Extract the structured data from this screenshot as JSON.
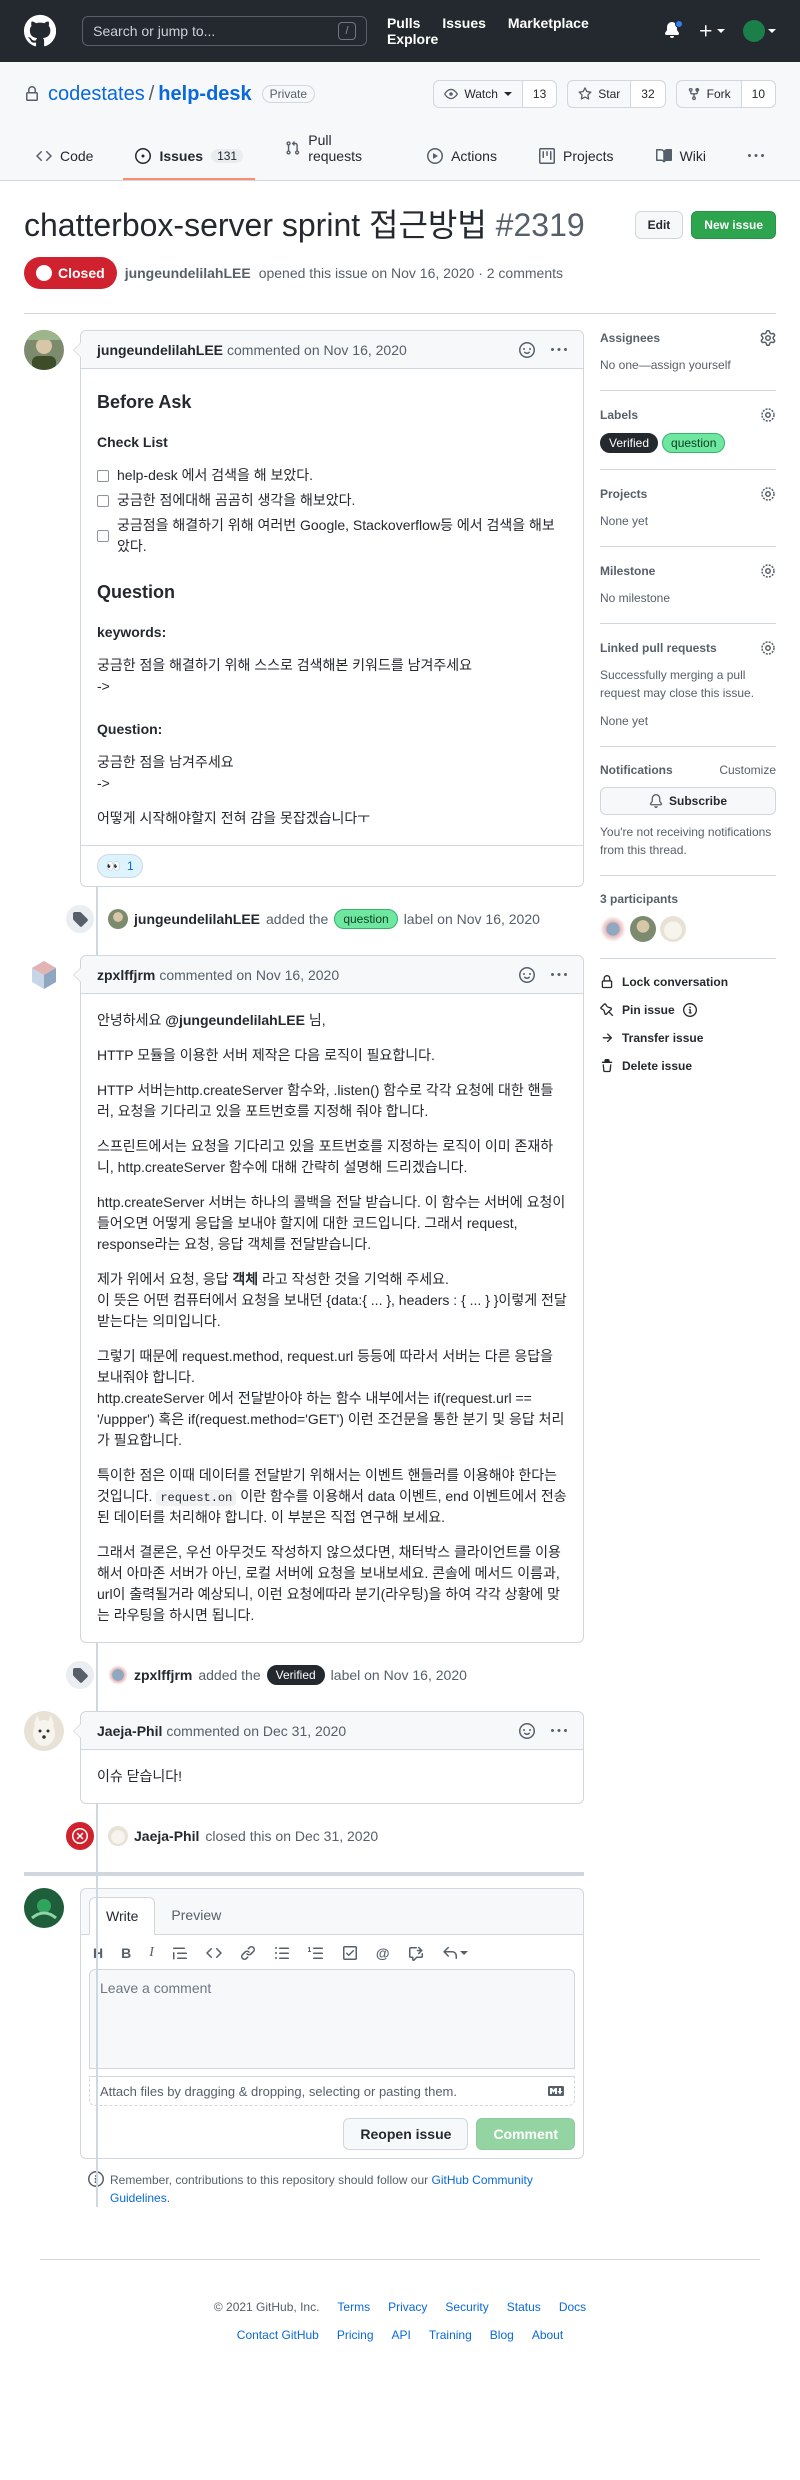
{
  "header": {
    "search_placeholder": "Search or jump to...",
    "search_key": "/",
    "nav": [
      "Pulls",
      "Issues",
      "Marketplace",
      "Explore"
    ]
  },
  "repo": {
    "owner": "codestates",
    "name": "help-desk",
    "visibility": "Private",
    "watch_label": "Watch",
    "watch_count": "13",
    "star_label": "Star",
    "star_count": "32",
    "fork_label": "Fork",
    "fork_count": "10",
    "tabs": [
      {
        "label": "Code"
      },
      {
        "label": "Issues",
        "count": "131"
      },
      {
        "label": "Pull requests"
      },
      {
        "label": "Actions"
      },
      {
        "label": "Projects"
      },
      {
        "label": "Wiki"
      }
    ]
  },
  "issue": {
    "title": "chatterbox-server sprint 접근방법",
    "number": "#2319",
    "edit_label": "Edit",
    "new_issue_label": "New issue",
    "state": "Closed",
    "author": "jungeundelilahLEE",
    "opened_text": "opened this issue on Nov 16, 2020 · 2 comments"
  },
  "comments": {
    "first": {
      "author": "jungeundelilahLEE",
      "meta": "commented on Nov 16, 2020",
      "heading": "Before Ask",
      "checklist_title": "Check List",
      "checklist": [
        "help-desk 에서 검색을 해 보았다.",
        "궁금한 점에대해 곰곰히 생각을 해보았다.",
        "궁금점을 해결하기 위해 여러번 Google, Stackoverflow등 에서 검색을 해보았다."
      ],
      "question_title": "Question",
      "keywords_label": "keywords:",
      "keywords_text": "궁금한 점을 해결하기 위해 스스로 검색해본 키워드를 남겨주세요",
      "keywords_arrow": "->",
      "question_label": "Question:",
      "question_text": "궁금한 점을 남겨주세요",
      "question_arrow": "->",
      "closing": "어떻게 시작해야할지 전혀 감을 못잡겠습니다ㅜ",
      "reaction_emoji": "👀",
      "reaction_count": "1"
    },
    "second": {
      "author": "zpxlffjrm",
      "meta": "commented on Nov 16, 2020",
      "greet_mention": "@jungeundelilahLEE",
      "greet_suffix": " 님,",
      "intro": "안녕하세요",
      "p1": "HTTP 모듈을 이용한 서버 제작은 다음 로직이 필요합니다.",
      "p2": "HTTP 서버는http.createServer 함수와, .listen() 함수로 각각 요청에 대한 핸들러, 요청을 기다리고 있을 포트번호를 지정해 줘야 합니다.",
      "p3": "스프린트에서는 요청을 기다리고 있을 포트번호를 지정하는 로직이 이미 존재하니, http.createServer 함수에 대해 간략히 설명해 드리겠습니다.",
      "p4": "http.createServer 서버는 하나의 콜백을 전달 받습니다. 이 함수는 서버에 요청이 들어오면 어떻게 응답을 보내야 할지에 대한 코드입니다. 그래서 request, response라는 요청, 응답 객체를 전달받습니다.",
      "p5a": "제가 위에서 요청, 응답 ",
      "p5b": "객체",
      "p5c": " 라고 작성한 것을 기억해 주세요.",
      "p5d": "이 뜻은 어떤 컴퓨터에서 요청을 보내던 {data:{ ... }, headers : { ... } }이렇게 전달받는다는 의미입니다.",
      "p6a": "그렇기 때문에 request.method, request.url 등등에 따라서 서버는 다른 응답을 보내줘야 합니다.",
      "p6b": "http.createServer 에서 전달받아야 하는 함수 내부에서는 if(request.url == '/uppper') 혹은 if(request.method='GET') 이런 조건문을 통한 분기 및 응답 처리가 필요합니다.",
      "p7a": "특이한 점은 이때 데이터를 전달받기 위해서는 이벤트 핸들러를 이용해야 한다는 것입니다. ",
      "p7code": "request.on",
      "p7b": " 이란 함수를 이용해서 data 이벤트, end 이벤트에서 전송된 데이터를 처리해야 합니다. 이 부분은 직접 연구해 보세요.",
      "p8": "그래서 결론은, 우선 아무것도 작성하지 않으셨다면, 채터박스 클라이언트를 이용해서 아마존 서버가 아닌, 로컬 서버에 요청을 보내보세요. 콘솔에 메서드 이름과, url이 출력될거라 예상되니, 이런 요청에따라 분기(라우팅)을 하여 각각 상황에 맞는 라우팅을 하시면 됩니다."
    },
    "third": {
      "author": "Jaeja-Phil",
      "meta": "commented on Dec 31, 2020",
      "body": "이슈 닫습니다!"
    }
  },
  "events": {
    "label_question": {
      "actor": "jungeundelilahLEE",
      "pre": "added the",
      "label": "question",
      "post": "label on Nov 16, 2020"
    },
    "label_verified": {
      "actor": "zpxlffjrm",
      "pre": "added the",
      "label": "Verified",
      "post": "label on Nov 16, 2020"
    },
    "closed": {
      "actor": "Jaeja-Phil",
      "post": "closed this on Dec 31, 2020"
    }
  },
  "new_comment": {
    "write_tab": "Write",
    "preview_tab": "Preview",
    "placeholder": "Leave a comment",
    "attach_text": "Attach files by dragging & dropping, selecting or pasting them.",
    "reopen_label": "Reopen issue",
    "comment_label": "Comment",
    "tip_pre": "Remember, contributions to this repository should follow our ",
    "tip_link": "GitHub Community Guidelines",
    "tip_post": "."
  },
  "sidebar": {
    "assignees_title": "Assignees",
    "assignees_text": "No one—assign yourself",
    "labels_title": "Labels",
    "labels": [
      "Verified",
      "question"
    ],
    "projects_title": "Projects",
    "projects_text": "None yet",
    "milestone_title": "Milestone",
    "milestone_text": "No milestone",
    "linked_title": "Linked pull requests",
    "linked_text": "Successfully merging a pull request may close this issue.",
    "linked_none": "None yet",
    "notifications_title": "Notifications",
    "customize": "Customize",
    "subscribe": "Subscribe",
    "notifications_text": "You're not receiving notifications from this thread.",
    "participants_title": "3 participants",
    "lock": "Lock conversation",
    "pin": "Pin issue",
    "transfer": "Transfer issue",
    "delete": "Delete issue"
  },
  "footer": {
    "copyright": "© 2021 GitHub, Inc.",
    "row1": [
      "Terms",
      "Privacy",
      "Security",
      "Status",
      "Docs"
    ],
    "row2": [
      "Contact GitHub",
      "Pricing",
      "API",
      "Training",
      "Blog",
      "About"
    ]
  },
  "colors": {
    "header_bg": "#24292f",
    "closed_red": "#cf222e",
    "new_issue_green": "#2da44e",
    "link_blue": "#0969da",
    "question_label": "#6ee7a0",
    "verified_label": "#24292f"
  }
}
